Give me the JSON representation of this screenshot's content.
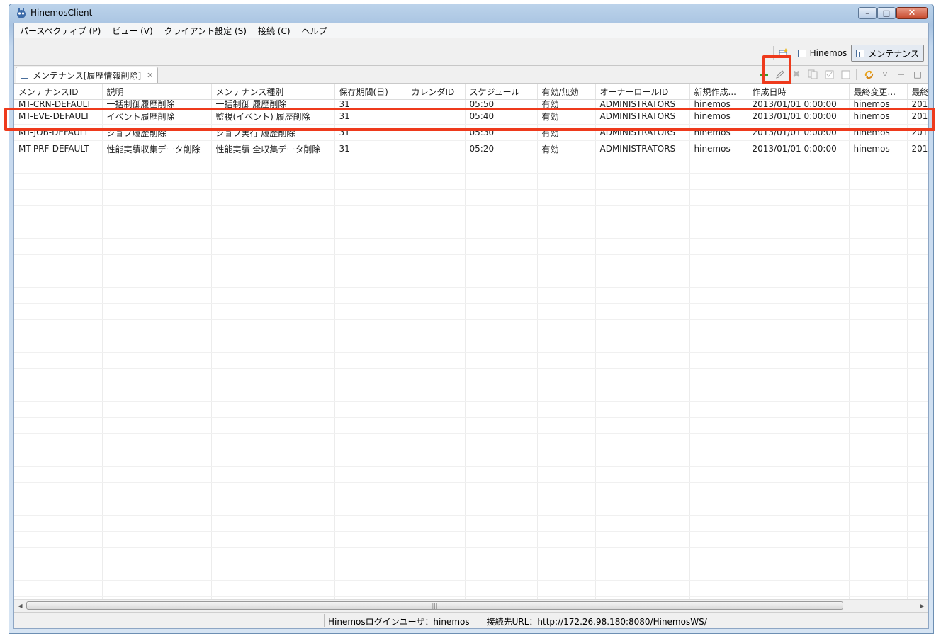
{
  "window": {
    "title": "HinemosClient"
  },
  "menu": [
    "パースペクティブ (P)",
    "ビュー (V)",
    "クライアント設定 (S)",
    "接続 (C)",
    "ヘルプ"
  ],
  "perspectives": {
    "items": [
      "Hinemos",
      "メンテナンス"
    ],
    "active": "メンテナンス"
  },
  "view": {
    "tab_label": "メンテナンス[履歴情報削除]",
    "toolbar_icons": [
      "add-icon",
      "edit-icon",
      "delete-icon",
      "copy-icon",
      "enable-icon",
      "disable-icon",
      "refresh-icon",
      "view-menu-icon",
      "minimize-icon",
      "maximize-icon"
    ]
  },
  "table": {
    "columns": [
      "メンテナンスID",
      "説明",
      "メンテナンス種別",
      "保存期間(日)",
      "カレンダID",
      "スケジュール",
      "有効/無効",
      "オーナーロールID",
      "新規作成...",
      "作成日時",
      "最終変更...",
      "最終"
    ],
    "rows": [
      [
        "MT-CRN-DEFAULT",
        "一括制御履歴削除",
        "一括制御 履歴削除",
        "31",
        "",
        "05:50",
        "有効",
        "ADMINISTRATORS",
        "hinemos",
        "2013/01/01 0:00:00",
        "hinemos",
        "201"
      ],
      [
        "MT-EVE-DEFAULT",
        "イベント履歴削除",
        "監視(イベント) 履歴削除",
        "31",
        "",
        "05:40",
        "有効",
        "ADMINISTRATORS",
        "hinemos",
        "2013/01/01 0:00:00",
        "hinemos",
        "201"
      ],
      [
        "MT-JOB-DEFAULT",
        "ジョブ履歴削除",
        "ジョブ実行 履歴削除",
        "31",
        "",
        "05:30",
        "有効",
        "ADMINISTRATORS",
        "hinemos",
        "2013/01/01 0:00:00",
        "hinemos",
        "201"
      ],
      [
        "MT-PRF-DEFAULT",
        "性能実績収集データ削除",
        "性能実績 全収集データ削除",
        "31",
        "",
        "05:20",
        "有効",
        "ADMINISTRATORS",
        "hinemos",
        "2013/01/01 0:00:00",
        "hinemos",
        "201"
      ]
    ],
    "selected_row": 1
  },
  "statusbar": {
    "text": "Hinemosログインユーザ：hinemos　　接続先URL：http://172.26.98.180:8080/HinemosWS/"
  },
  "colors": {
    "highlight": "#ee3a1c",
    "frame": "#a9c4e2"
  }
}
